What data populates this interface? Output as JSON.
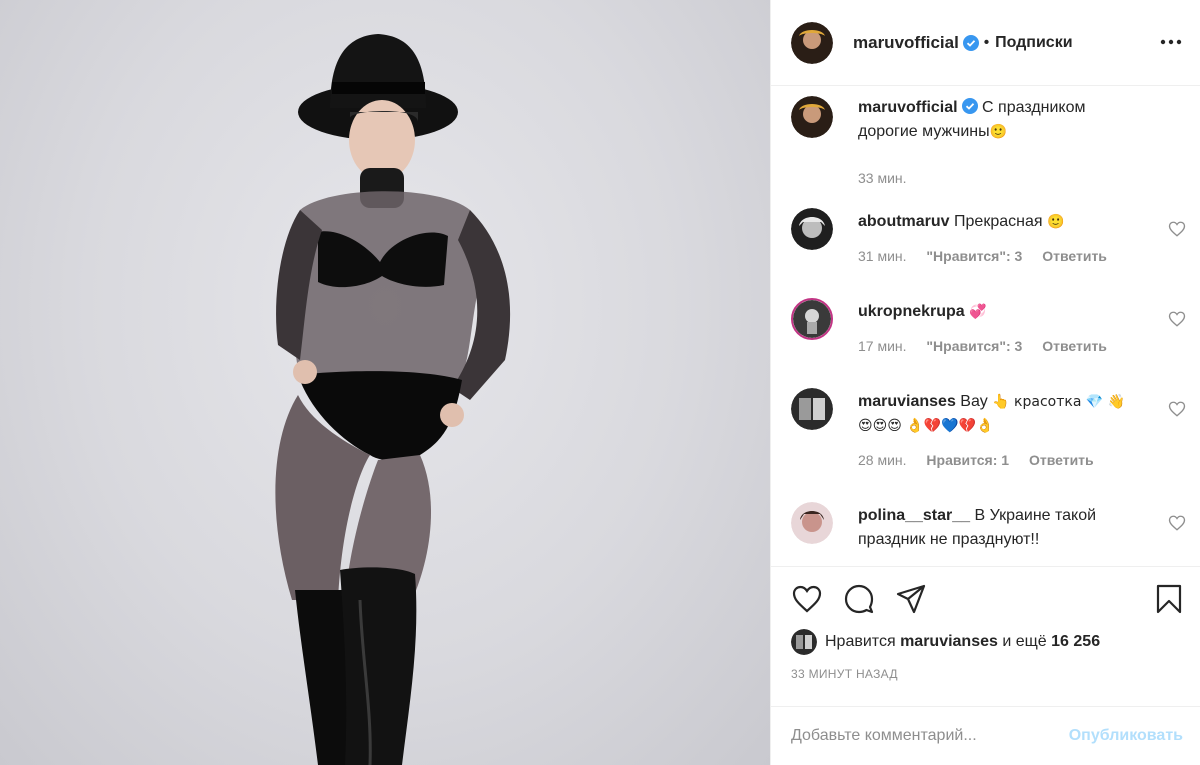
{
  "post": {
    "author": "maruvofficial",
    "follow_label": "Подписки",
    "dot": "•",
    "caption": "С праздником дорогие мужчины",
    "caption_emoji": "🙂",
    "caption_time": "33 мин."
  },
  "comments": [
    {
      "user": "aboutmaruv",
      "text": "Прекрасная",
      "emoji": "🙂",
      "time": "31 мин.",
      "likes": "\"Нравится\": 3",
      "reply": "Ответить"
    },
    {
      "user": "ukropnekrupa",
      "text": "",
      "emoji": "💞",
      "time": "17 мин.",
      "likes": "\"Нравится\": 3",
      "reply": "Ответить"
    },
    {
      "user": "maruvianses",
      "text": "Вау",
      "emoji": "👆 красотка 💎 👋😍😍😍 👌💔💙💔👌",
      "time": "28 мин.",
      "likes": "Нравится: 1",
      "reply": "Ответить"
    },
    {
      "user": "polina__star__",
      "text": "В Украине такой праздник не празднуют!!",
      "emoji": "",
      "time": "",
      "likes": "",
      "reply": ""
    }
  ],
  "likes": {
    "prefix": "Нравится",
    "user": "maruvianses",
    "middle": "и ещё",
    "count": "16 256"
  },
  "timeago": "33 МИНУТ НАЗАД",
  "composer": {
    "placeholder": "Добавьте комментарий...",
    "publish": "Опубликовать"
  },
  "icons": {
    "more": "more-icon",
    "verified": "verified-badge-icon",
    "like": "heart-icon",
    "comment": "comment-icon",
    "share": "share-icon",
    "save": "bookmark-icon"
  },
  "colors": {
    "verified": "#3897f0",
    "publish": "#b2dffc",
    "muted": "#8e8e8e"
  }
}
